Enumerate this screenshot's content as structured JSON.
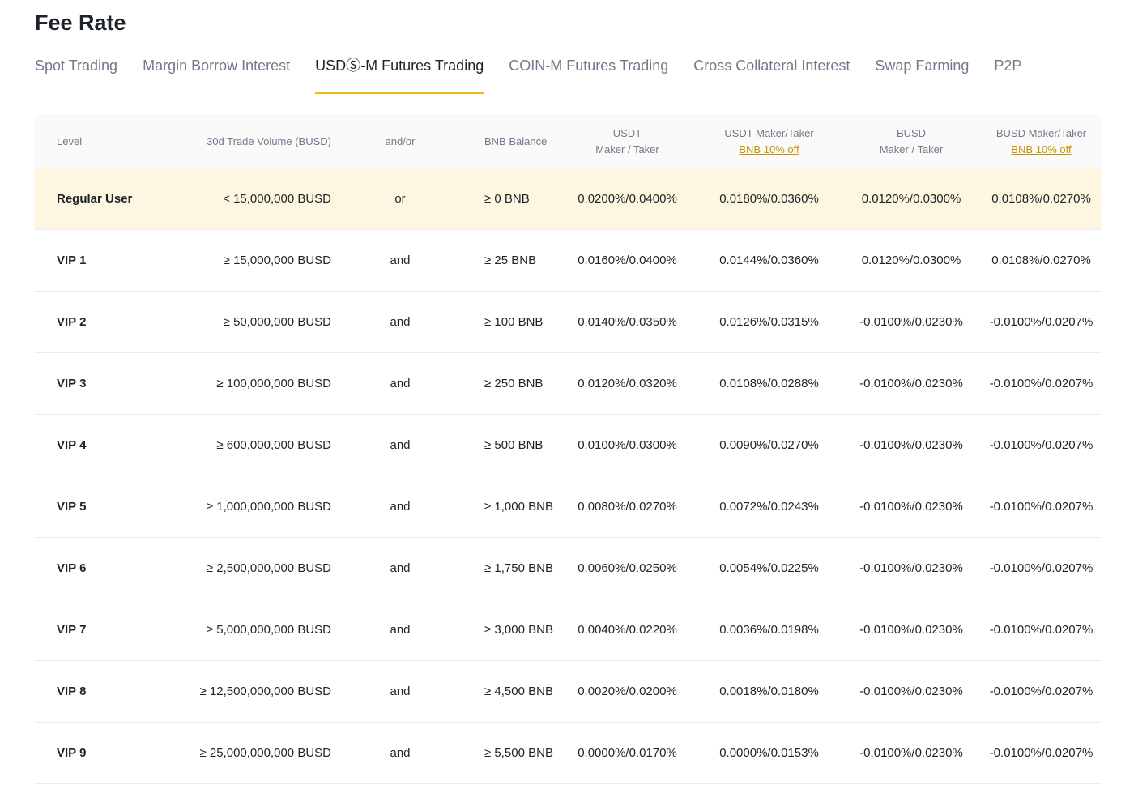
{
  "page": {
    "title": "Fee Rate"
  },
  "tabs": [
    {
      "label": "Spot Trading"
    },
    {
      "label": "Margin Borrow Interest"
    },
    {
      "label": "USDⓈ-M Futures Trading"
    },
    {
      "label": "COIN-M Futures Trading"
    },
    {
      "label": "Cross Collateral Interest"
    },
    {
      "label": "Swap Farming"
    },
    {
      "label": "P2P"
    }
  ],
  "active_tab": 2,
  "colors": {
    "accent": "#f0b90b",
    "highlight_row": "#fdf6e1",
    "discount_link": "#c99400"
  },
  "table": {
    "headers": {
      "level": "Level",
      "volume": "30d Trade Volume (BUSD)",
      "andor": "and/or",
      "bnb": "BNB Balance",
      "usdt_line1": "USDT",
      "usdt_line2": "Maker / Taker",
      "usdt_bnb_line1": "USDT Maker/Taker",
      "usdt_bnb_discount": "BNB 10% off",
      "busd_line1": "BUSD",
      "busd_line2": "Maker / Taker",
      "busd_bnb_line1": "BUSD Maker/Taker",
      "busd_bnb_discount": "BNB 10% off"
    },
    "rows": [
      {
        "level": "Regular User",
        "volume": "< 15,000,000 BUSD",
        "andor": "or",
        "bnb": "≥ 0 BNB",
        "usdt": "0.0200%/0.0400%",
        "usdt_bnb": "0.0180%/0.0360%",
        "busd": "0.0120%/0.0300%",
        "busd_bnb": "0.0108%/0.0270%"
      },
      {
        "level": "VIP 1",
        "volume": "≥ 15,000,000 BUSD",
        "andor": "and",
        "bnb": "≥ 25 BNB",
        "usdt": "0.0160%/0.0400%",
        "usdt_bnb": "0.0144%/0.0360%",
        "busd": "0.0120%/0.0300%",
        "busd_bnb": "0.0108%/0.0270%"
      },
      {
        "level": "VIP 2",
        "volume": "≥ 50,000,000 BUSD",
        "andor": "and",
        "bnb": "≥ 100 BNB",
        "usdt": "0.0140%/0.0350%",
        "usdt_bnb": "0.0126%/0.0315%",
        "busd": "-0.0100%/0.0230%",
        "busd_bnb": "-0.0100%/0.0207%"
      },
      {
        "level": "VIP 3",
        "volume": "≥ 100,000,000 BUSD",
        "andor": "and",
        "bnb": "≥ 250 BNB",
        "usdt": "0.0120%/0.0320%",
        "usdt_bnb": "0.0108%/0.0288%",
        "busd": "-0.0100%/0.0230%",
        "busd_bnb": "-0.0100%/0.0207%"
      },
      {
        "level": "VIP 4",
        "volume": "≥ 600,000,000 BUSD",
        "andor": "and",
        "bnb": "≥ 500 BNB",
        "usdt": "0.0100%/0.0300%",
        "usdt_bnb": "0.0090%/0.0270%",
        "busd": "-0.0100%/0.0230%",
        "busd_bnb": "-0.0100%/0.0207%"
      },
      {
        "level": "VIP 5",
        "volume": "≥ 1,000,000,000 BUSD",
        "andor": "and",
        "bnb": "≥ 1,000 BNB",
        "usdt": "0.0080%/0.0270%",
        "usdt_bnb": "0.0072%/0.0243%",
        "busd": "-0.0100%/0.0230%",
        "busd_bnb": "-0.0100%/0.0207%"
      },
      {
        "level": "VIP 6",
        "volume": "≥ 2,500,000,000 BUSD",
        "andor": "and",
        "bnb": "≥ 1,750 BNB",
        "usdt": "0.0060%/0.0250%",
        "usdt_bnb": "0.0054%/0.0225%",
        "busd": "-0.0100%/0.0230%",
        "busd_bnb": "-0.0100%/0.0207%"
      },
      {
        "level": "VIP 7",
        "volume": "≥ 5,000,000,000 BUSD",
        "andor": "and",
        "bnb": "≥ 3,000 BNB",
        "usdt": "0.0040%/0.0220%",
        "usdt_bnb": "0.0036%/0.0198%",
        "busd": "-0.0100%/0.0230%",
        "busd_bnb": "-0.0100%/0.0207%"
      },
      {
        "level": "VIP 8",
        "volume": "≥ 12,500,000,000 BUSD",
        "andor": "and",
        "bnb": "≥ 4,500 BNB",
        "usdt": "0.0020%/0.0200%",
        "usdt_bnb": "0.0018%/0.0180%",
        "busd": "-0.0100%/0.0230%",
        "busd_bnb": "-0.0100%/0.0207%"
      },
      {
        "level": "VIP 9",
        "volume": "≥ 25,000,000,000 BUSD",
        "andor": "and",
        "bnb": "≥ 5,500 BNB",
        "usdt": "0.0000%/0.0170%",
        "usdt_bnb": "0.0000%/0.0153%",
        "busd": "-0.0100%/0.0230%",
        "busd_bnb": "-0.0100%/0.0207%"
      }
    ]
  }
}
